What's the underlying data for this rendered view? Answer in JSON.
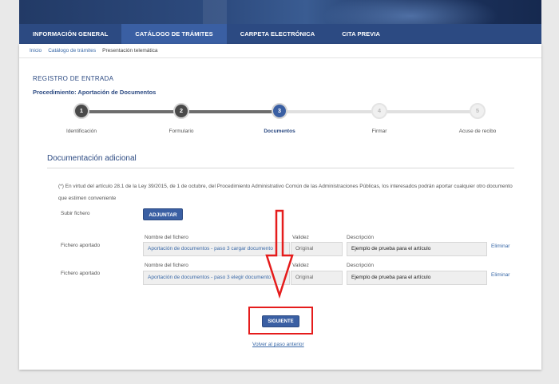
{
  "nav": {
    "items": [
      {
        "label": "INFORMACIÓN GENERAL",
        "active": false
      },
      {
        "label": "CATÁLOGO DE TRÁMITES",
        "active": true
      },
      {
        "label": "CARPETA ELECTRÓNICA",
        "active": false
      },
      {
        "label": "CITA PREVIA",
        "active": false
      }
    ]
  },
  "breadcrumb": {
    "items": [
      "Inicio",
      "Catálogo de trámites"
    ],
    "current": "Presentación telemática"
  },
  "page": {
    "title": "REGISTRO DE ENTRADA",
    "procedure": "Procedimiento: Aportación de Documentos"
  },
  "stepper": {
    "steps": [
      {
        "number": "1",
        "label": "Identificación",
        "state": "done"
      },
      {
        "number": "2",
        "label": "Formulario",
        "state": "done"
      },
      {
        "number": "3",
        "label": "Documentos",
        "state": "current"
      },
      {
        "number": "4",
        "label": "Firmar",
        "state": "pending"
      },
      {
        "number": "5",
        "label": "Acuse de recibo",
        "state": "pending"
      }
    ]
  },
  "section": {
    "title": "Documentación adicional",
    "info": "(*) En virtud del artículo 28.1 de la Ley 39/2015, de 1 de octubre, del Procedimiento Administrativo Común de las Administraciones Públicas, los interesados podrán aportar cualquier otro documento que estimen conveniente"
  },
  "upload": {
    "label": "Subir fichero",
    "button": "ADJUNTAR"
  },
  "files": [
    {
      "label": "Fichero aportado",
      "name_header": "Nombre del fichero",
      "name": "Aportación de documentos - paso 3 cargar documento",
      "validity_header": "Validez",
      "validity": "Original",
      "description_header": "Descripción",
      "description": "Ejemplo de prueba para el artículo",
      "action": "Eliminar"
    },
    {
      "label": "Fichero aportado",
      "name_header": "Nombre del fichero",
      "name": "Aportación de documentos - paso 3 elegir documento",
      "validity_header": "Validez",
      "validity": "Original",
      "description_header": "Descripción",
      "description": "Ejemplo de prueba para el artículo",
      "action": "Eliminar"
    }
  ],
  "actions": {
    "next": "SIGUIENTE",
    "back": "Volver al paso anterior"
  },
  "colors": {
    "brand": "#2c4a82",
    "accent": "#3a5fa3",
    "annotation": "#e51c1c"
  }
}
